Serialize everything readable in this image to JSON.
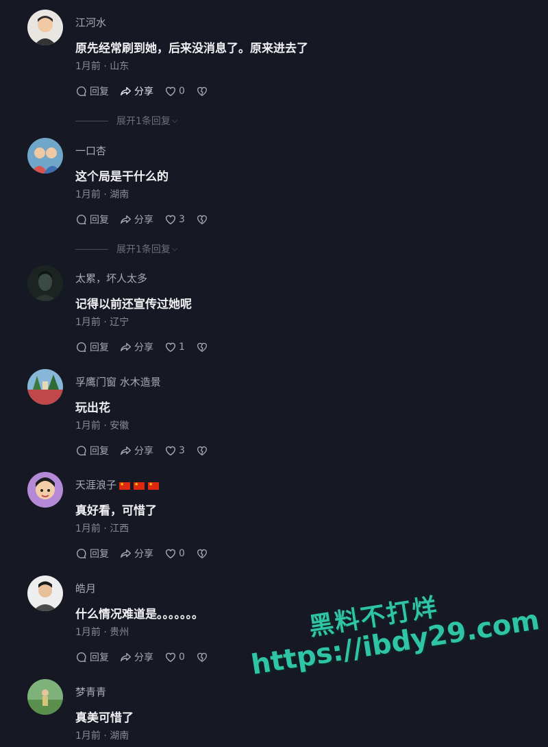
{
  "comments": [
    {
      "username": "江河水",
      "text": "原先经常刷到她，后来没消息了。原来进去了",
      "meta": "1月前 · 山东",
      "reply": "回复",
      "share": "分享",
      "likes": "0",
      "expand": "展开1条回复"
    },
    {
      "username": "一口杏",
      "text": "这个局是干什么的",
      "meta": "1月前 · 湖南",
      "reply": "回复",
      "share": "分享",
      "likes": "3",
      "expand": "展开1条回复"
    },
    {
      "username": "太累，坏人太多",
      "text": "记得以前还宣传过她呢",
      "meta": "1月前 · 辽宁",
      "reply": "回复",
      "share": "分享",
      "likes": "1"
    },
    {
      "username": "孚鹰门窗 水木造景",
      "text": "玩出花",
      "meta": "1月前 · 安徽",
      "reply": "回复",
      "share": "分享",
      "likes": "3"
    },
    {
      "username": "天涯浪子",
      "text": "真好看，可惜了",
      "meta": "1月前 · 江西",
      "reply": "回复",
      "share": "分享",
      "likes": "0"
    },
    {
      "username": "皓月",
      "text": "什么情况难道是。。。。。。。",
      "meta": "1月前 · 贵州",
      "reply": "回复",
      "share": "分享",
      "likes": "0"
    },
    {
      "username": "梦青青",
      "text": "真美可惜了",
      "meta": "1月前 · 湖南"
    }
  ],
  "watermark": {
    "line1": "黑料不打烊",
    "line2": "https://ibdy29.com"
  }
}
